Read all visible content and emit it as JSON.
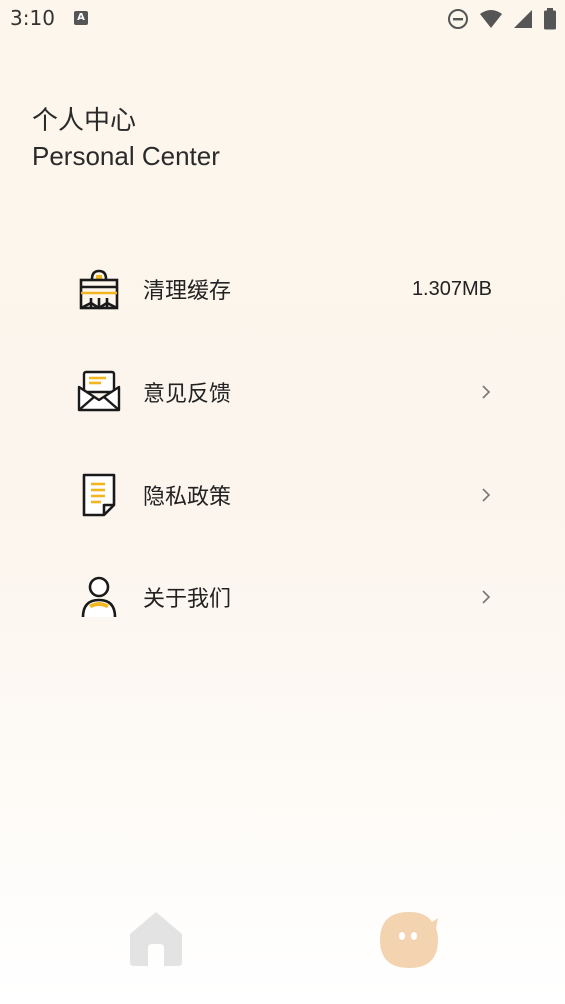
{
  "status_bar": {
    "time": "3:10",
    "notification_icon": "text-a-icon",
    "icons": [
      "do-not-disturb-icon",
      "wifi-icon",
      "signal-icon",
      "battery-icon"
    ]
  },
  "header": {
    "title_zh": "个人中心",
    "title_en": "Personal Center"
  },
  "menu": {
    "items": [
      {
        "label": "清理缓存",
        "icon": "storage-cabinet-icon",
        "value": "1.307MB"
      },
      {
        "label": "意见反馈",
        "icon": "envelope-icon",
        "value": ""
      },
      {
        "label": "隐私政策",
        "icon": "document-icon",
        "value": ""
      },
      {
        "label": "关于我们",
        "icon": "person-icon",
        "value": ""
      }
    ]
  },
  "bottom_nav": {
    "items": [
      {
        "icon": "home-icon",
        "active": false
      },
      {
        "icon": "chat-face-icon",
        "active": true
      }
    ]
  },
  "colors": {
    "accent_yellow": "#f2b61f",
    "icon_dark": "#1a1a1a",
    "nav_inactive": "#e3e3e3",
    "nav_active": "#f3d3b0"
  }
}
